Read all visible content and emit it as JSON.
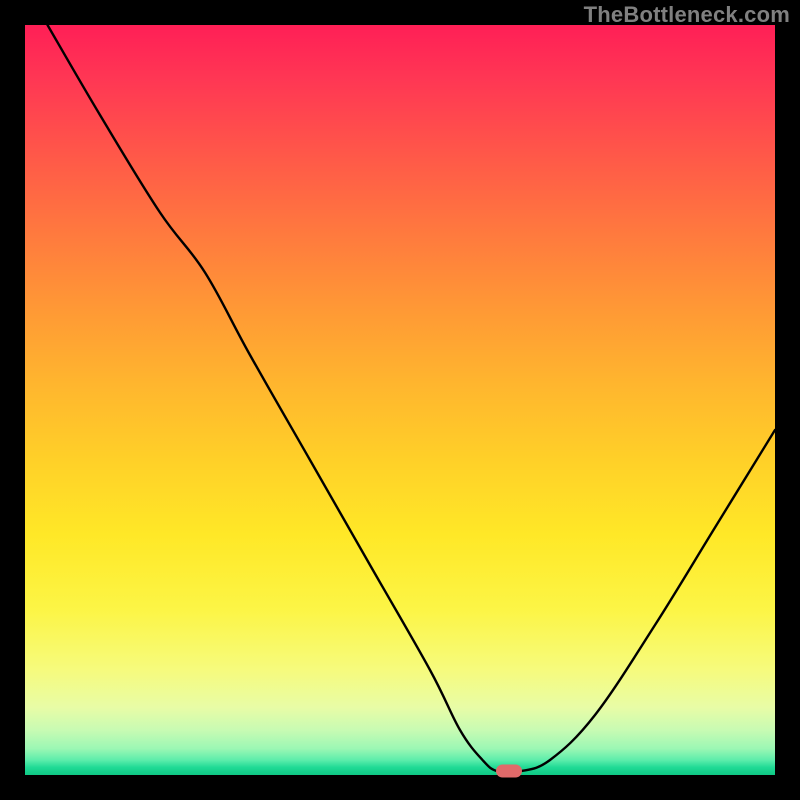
{
  "watermark": "TheBottleneck.com",
  "chart_data": {
    "type": "line",
    "title": "",
    "xlabel": "",
    "ylabel": "",
    "xlim": [
      0,
      100
    ],
    "ylim": [
      0,
      100
    ],
    "grid": false,
    "legend": false,
    "series": [
      {
        "name": "bottleneck-curve",
        "color": "#000000",
        "x": [
          3,
          10,
          18,
          24,
          30,
          38,
          46,
          54,
          58,
          61,
          63,
          66,
          70,
          76,
          84,
          92,
          100
        ],
        "y": [
          100,
          88,
          75,
          67,
          56,
          42,
          28,
          14,
          6,
          2,
          0.5,
          0.5,
          2,
          8,
          20,
          33,
          46
        ]
      }
    ],
    "marker": {
      "x": 64.5,
      "y": 0.5,
      "color": "#e06a6a"
    },
    "background_gradient": {
      "stops": [
        {
          "pos": 0.0,
          "color": "#ff1f56"
        },
        {
          "pos": 0.5,
          "color": "#ffd028"
        },
        {
          "pos": 0.85,
          "color": "#f6fb7d"
        },
        {
          "pos": 1.0,
          "color": "#0fc884"
        }
      ]
    }
  }
}
